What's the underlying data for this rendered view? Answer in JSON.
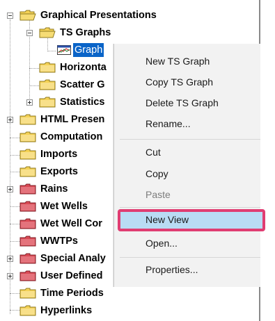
{
  "tree": {
    "items": [
      {
        "label": "Graphical Presentations"
      },
      {
        "label": "TS Graphs"
      },
      {
        "label": "Graph"
      },
      {
        "label": "Horizonta"
      },
      {
        "label": "Scatter G"
      },
      {
        "label": "Statistics"
      },
      {
        "label": "HTML Presen"
      },
      {
        "label": "Computation"
      },
      {
        "label": "Imports"
      },
      {
        "label": "Exports"
      },
      {
        "label": "Rains"
      },
      {
        "label": "Wet Wells"
      },
      {
        "label": "Wet Well Cor"
      },
      {
        "label": "WWTPs"
      },
      {
        "label": "Special Analy"
      },
      {
        "label": "User Defined"
      },
      {
        "label": "Time Periods"
      },
      {
        "label": "Hyperlinks"
      }
    ]
  },
  "context_menu": {
    "items": [
      {
        "label": "New TS Graph",
        "enabled": true
      },
      {
        "label": "Copy TS Graph",
        "enabled": true
      },
      {
        "label": "Delete TS Graph",
        "enabled": true
      },
      {
        "label": "Rename...",
        "enabled": true
      },
      {
        "label": "Cut",
        "enabled": true
      },
      {
        "label": "Copy",
        "enabled": true
      },
      {
        "label": "Paste",
        "enabled": false
      },
      {
        "label": "New View",
        "enabled": true,
        "highlighted": true
      },
      {
        "label": "Open...",
        "enabled": true
      },
      {
        "label": "Properties...",
        "enabled": true
      }
    ]
  },
  "colors": {
    "selection": "#0a64c8",
    "menu_bg": "#f2f2f2",
    "highlight_fill": "#b9dcf4",
    "highlight_border": "#e03d72",
    "folder_yellow": "#f4d257",
    "folder_red": "#d94a55"
  },
  "icons": {
    "folder": "folder-icon",
    "folder_open": "folder-open-icon",
    "red_folder": "red-folder-icon",
    "graph": "graph-icon",
    "expand": "expand-icon",
    "collapse": "collapse-icon"
  }
}
